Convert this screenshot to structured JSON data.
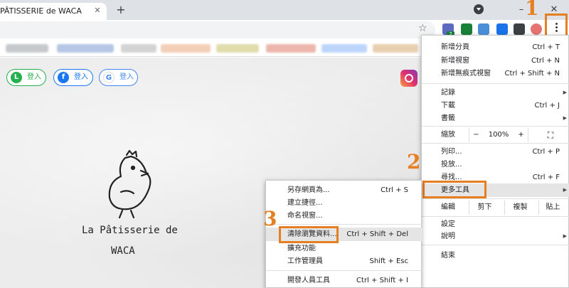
{
  "tab": {
    "title": "PÂTISSERIE de WACA",
    "close": "✕",
    "new_tab": "+"
  },
  "window": {
    "minimize": "–",
    "close": "✕"
  },
  "toolbar": {
    "star": "☆",
    "badge": "2"
  },
  "login": {
    "line": {
      "label": "登入",
      "icon": "L"
    },
    "facebook": {
      "label": "登入",
      "icon": "f"
    },
    "google": {
      "label": "登入",
      "icon": "G"
    }
  },
  "logo": {
    "line1": "La Pâtisserie de",
    "line2": "WACA"
  },
  "main_menu": {
    "new_tab": {
      "label": "新增分頁",
      "shortcut": "Ctrl + T"
    },
    "new_window": {
      "label": "新增視窗",
      "shortcut": "Ctrl + N"
    },
    "incognito": {
      "label": "新增無痕式視窗",
      "shortcut": "Ctrl + Shift + N"
    },
    "history": {
      "label": "記錄"
    },
    "downloads": {
      "label": "下載",
      "shortcut": "Ctrl + J"
    },
    "bookmarks": {
      "label": "書籤"
    },
    "zoom": {
      "label": "縮放",
      "minus": "−",
      "value": "100%",
      "plus": "+",
      "fullscreen": "⛶"
    },
    "print": {
      "label": "列印...",
      "shortcut": "Ctrl + P"
    },
    "cast": {
      "label": "投放..."
    },
    "find": {
      "label": "尋找...",
      "shortcut": "Ctrl + F"
    },
    "more_tools": {
      "label": "更多工具"
    },
    "edit": {
      "label": "編輯",
      "cut": "剪下",
      "copy": "複製",
      "paste": "貼上"
    },
    "settings": {
      "label": "設定"
    },
    "help": {
      "label": "說明"
    },
    "exit": {
      "label": "結束"
    }
  },
  "sub_menu": {
    "save_page": {
      "label": "另存網頁為...",
      "shortcut": "Ctrl + S"
    },
    "create_shortcut": {
      "label": "建立捷徑..."
    },
    "name_window": {
      "label": "命名視窗..."
    },
    "clear_data": {
      "label": "清除瀏覽資料...",
      "shortcut": "Ctrl + Shift + Del"
    },
    "extensions": {
      "label": "擴充功能"
    },
    "task_manager": {
      "label": "工作管理員",
      "shortcut": "Shift + Esc"
    },
    "devtools": {
      "label": "開發人員工具",
      "shortcut": "Ctrl + Shift + I"
    }
  },
  "steps": {
    "one": "1",
    "two": "2",
    "three": "3"
  },
  "colors": {
    "highlight": "#e67e22",
    "line_green": "#22b14c",
    "facebook_blue": "#1877f2",
    "google_blue": "#4285f4"
  }
}
